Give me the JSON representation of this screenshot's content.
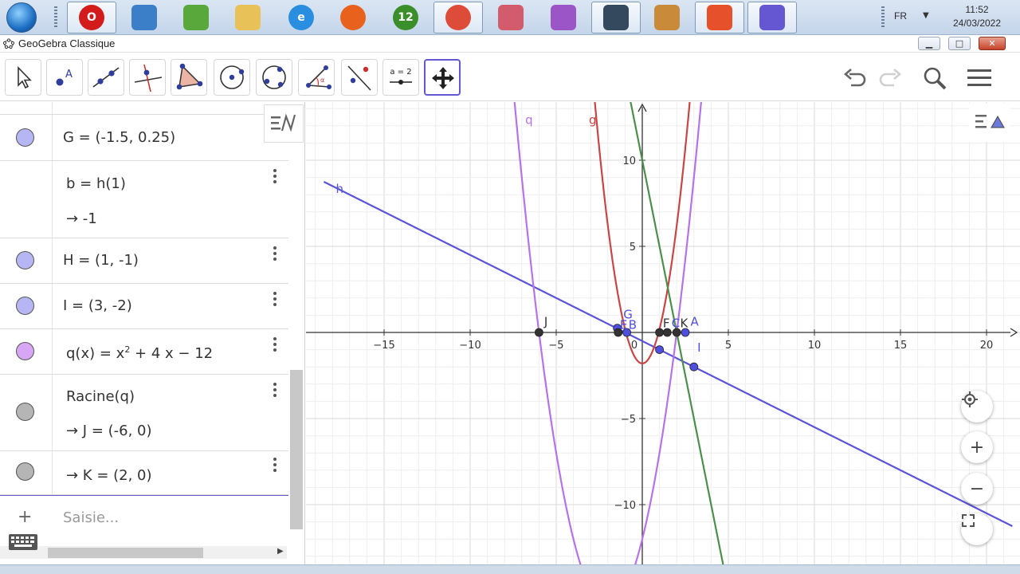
{
  "taskbar": {
    "apps": [
      {
        "name": "opera",
        "label": "O",
        "color": "#d31b1b",
        "active": true
      },
      {
        "name": "control-panel",
        "label": "",
        "color": "#3b7fc8",
        "active": false
      },
      {
        "name": "calculator",
        "label": "",
        "color": "#59a83b",
        "active": false
      },
      {
        "name": "file-explorer",
        "label": "",
        "color": "#e9c159",
        "active": false
      },
      {
        "name": "internet-explorer",
        "label": "e",
        "color": "#2a8ee0",
        "active": false
      },
      {
        "name": "firefox",
        "label": "",
        "color": "#e8621d",
        "active": false
      },
      {
        "name": "app-12",
        "label": "12",
        "color": "#3a8f2a",
        "active": false
      },
      {
        "name": "chrome",
        "label": "",
        "color": "#dd4b39",
        "active": true
      },
      {
        "name": "snipping-tool",
        "label": "",
        "color": "#d25b6c",
        "active": false
      },
      {
        "name": "paint-rainbow",
        "label": "",
        "color": "#9b55c7",
        "active": false
      },
      {
        "name": "movie-maker",
        "label": "",
        "color": "#34495e",
        "active": true
      },
      {
        "name": "paint",
        "label": "",
        "color": "#c98b3a",
        "active": false
      },
      {
        "name": "photo-app",
        "label": "",
        "color": "#e6502a",
        "active": true
      },
      {
        "name": "geogebra",
        "label": "",
        "color": "#6557d2",
        "active": true
      }
    ],
    "language": "FR",
    "time": "11:52",
    "date": "24/03/2022"
  },
  "window": {
    "title": "GeoGebra Classique",
    "minimize": "▁",
    "maximize": "□",
    "close": "✕"
  },
  "toolbar": {
    "tools": [
      "move-tool",
      "point-tool",
      "line-tool",
      "perpendicular-tool",
      "polygon-tool",
      "circle-center-tool",
      "circle-three-points-tool",
      "angle-tool",
      "reflect-tool",
      "slider-tool",
      "move-graphics-tool"
    ],
    "slider_label": "a = 2",
    "point_label": "A"
  },
  "algebra": {
    "rows": [
      {
        "text": "G = (-1.5, 0.25)",
        "color": "#b7b6f4"
      },
      {
        "text": "b = h(1)",
        "result": "→  -1"
      },
      {
        "text": "H = (1, -1)",
        "color": "#b7b6f4"
      },
      {
        "text": "I = (3, -2)",
        "color": "#b7b6f4"
      },
      {
        "text_prefix": "q(x)  =  x",
        "text_sup": "2",
        "text_suffix": " + 4 x − 12",
        "color": "#d7a6f4"
      },
      {
        "text": "Racine(q)",
        "result": "→  J = (-6, 0)",
        "color": "#b5b5b5"
      },
      {
        "text": "→  K = (2, 0)",
        "color": "#b5b5b5"
      }
    ],
    "input_plus": "+",
    "input_placeholder": "Saisie..."
  },
  "graphics": {
    "x_ticks": [
      "−15",
      "−10",
      "−5",
      "0",
      "5",
      "10",
      "15",
      "20"
    ],
    "y_ticks": [
      "10",
      "5",
      "−5",
      "−10"
    ],
    "labels": {
      "h": "h",
      "q": "q",
      "g": "g",
      "J": "J",
      "I": "I",
      "A": "A",
      "K": "K",
      "F": "F",
      "C": "C",
      "B": "B",
      "E": "E",
      "G": "G"
    },
    "colors": {
      "h": "#5a54d6",
      "q": "#b673e8",
      "g": "#c84545",
      "green": "#4a8f4a",
      "point_blue": "#4f4fe0",
      "point_black": "#333333"
    },
    "buttons": {
      "zoom_in": "+",
      "zoom_out": "−"
    }
  }
}
